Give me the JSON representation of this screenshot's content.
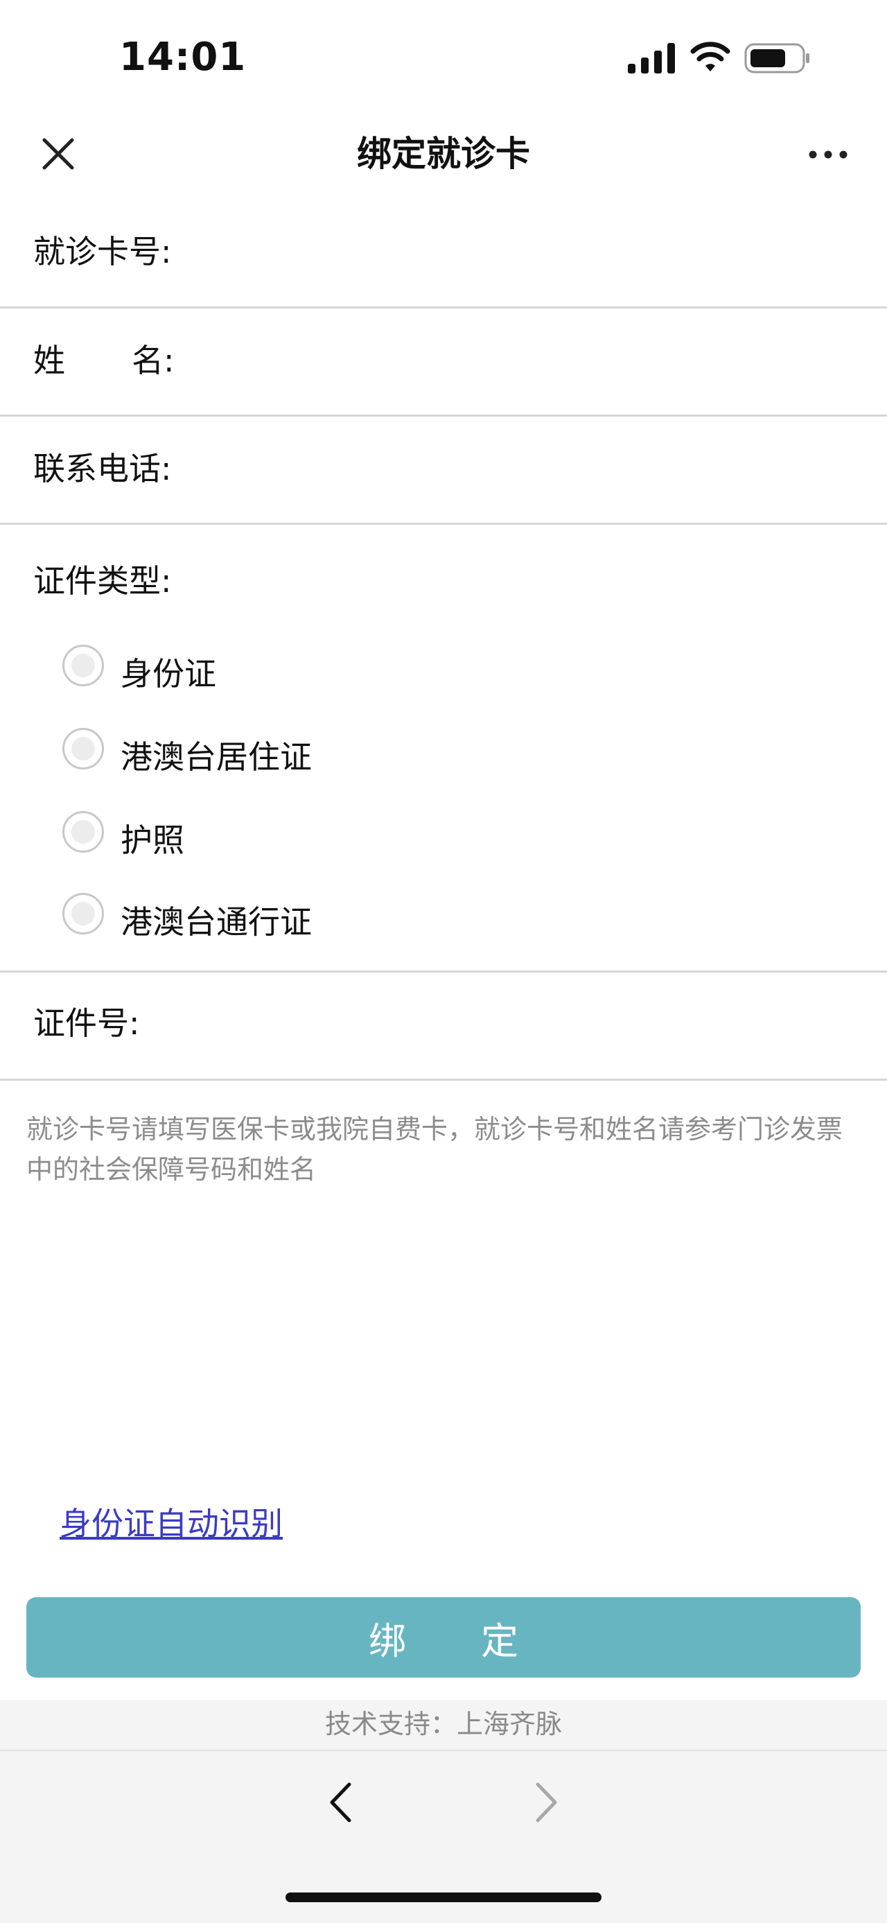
{
  "status_bar": {
    "time": "14:01"
  },
  "nav": {
    "title": "绑定就诊卡",
    "close_icon": "close-icon",
    "more_icon": "more-icon"
  },
  "form": {
    "card_number": {
      "label": "就诊卡号:",
      "value": ""
    },
    "name": {
      "label_first": "姓",
      "label_second": "名:",
      "value": ""
    },
    "phone": {
      "label": "联系电话:",
      "value": ""
    },
    "id_type": {
      "label": "证件类型:",
      "options": [
        {
          "label": "身份证",
          "checked": false
        },
        {
          "label": "港澳台居住证",
          "checked": false
        },
        {
          "label": "护照",
          "checked": false
        },
        {
          "label": "港澳台通行证",
          "checked": false
        }
      ]
    },
    "id_number": {
      "label": "证件号:",
      "value": ""
    }
  },
  "hint": "就诊卡号请填写医保卡或我院自费卡，就诊卡号和姓名请参考门诊发票中的社会保障号码和姓名",
  "ocr_link": "身份证自动识别",
  "submit_label": "绑　　定",
  "support": "技术支持：上海齐脉",
  "colors": {
    "accent_button": "#68b5c2",
    "link": "#3b3bc4",
    "hint_text": "#8c8c8c"
  }
}
